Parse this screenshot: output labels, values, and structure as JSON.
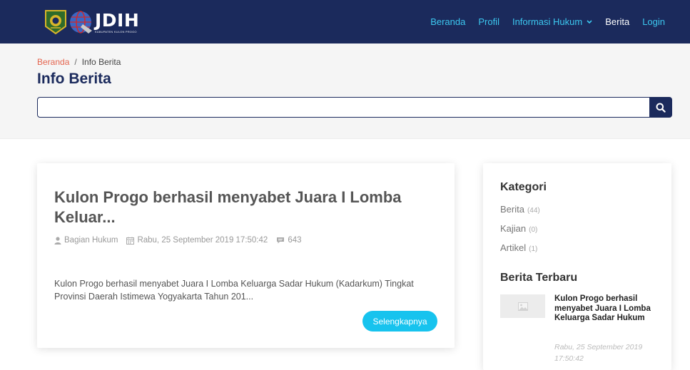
{
  "brand": {
    "title": "JDIH",
    "subtitle": "KABUPATEN KULON PROGO"
  },
  "nav": {
    "items": [
      {
        "label": "Beranda"
      },
      {
        "label": "Profil"
      },
      {
        "label": "Informasi Hukum"
      },
      {
        "label": "Berita"
      },
      {
        "label": "Login"
      }
    ]
  },
  "breadcrumb": {
    "home": "Beranda",
    "separator": "/",
    "current": "Info Berita"
  },
  "page": {
    "title": "Info Berita"
  },
  "search": {
    "value": "",
    "placeholder": ""
  },
  "post": {
    "title": "Kulon Progo berhasil menyabet Juara I Lomba Keluar...",
    "author": "Bagian Hukum",
    "date": "Rabu, 25 September 2019 17:50:42",
    "comments": "643",
    "excerpt": "Kulon Progo berhasil menyabet Juara I Lomba Keluarga Sadar Hukum (Kadarkum) Tingkat Provinsi Daerah Istimewa Yogyakarta Tahun 201...",
    "read_more": "Selengkapnya"
  },
  "sidebar": {
    "category_heading": "Kategori",
    "categories": [
      {
        "label": "Berita",
        "count": "(44)"
      },
      {
        "label": "Kajian",
        "count": "(0)"
      },
      {
        "label": "Artikel",
        "count": "(1)"
      }
    ],
    "recent_heading": "Berita Terbaru",
    "recent": {
      "title": "Kulon Progo berhasil menyabet Juara I Lomba Keluarga Sadar Hukum",
      "date": "Rabu, 25 September 2019 17:50:42"
    }
  },
  "colors": {
    "navbar": "#1b2a5c",
    "nav_link": "#3cc8f0",
    "accent_button": "#17c3ee",
    "breadcrumb_link": "#e4654f"
  }
}
